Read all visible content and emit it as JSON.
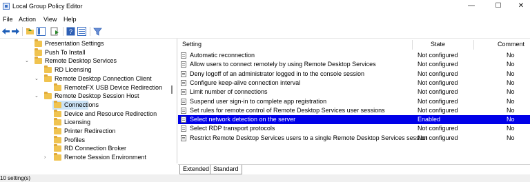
{
  "window": {
    "title": "Local Group Policy Editor",
    "minimize": "—",
    "maximize": "☐",
    "close": "✕"
  },
  "menu": [
    "File",
    "Action",
    "View",
    "Help"
  ],
  "tree": [
    {
      "label": "Presentation Settings",
      "level": 3,
      "chevron": ""
    },
    {
      "label": "Push To Install",
      "level": 3,
      "chevron": ""
    },
    {
      "label": "Remote Desktop Services",
      "level": 3,
      "chevron": "expanded"
    },
    {
      "label": "RD Licensing",
      "level": 4,
      "chevron": ""
    },
    {
      "label": "Remote Desktop Connection Client",
      "level": 4,
      "chevron": "expanded"
    },
    {
      "label": "RemoteFX USB Device Redirection",
      "level": 5,
      "chevron": ""
    },
    {
      "label": "Remote Desktop Session Host",
      "level": 4,
      "chevron": "expanded"
    },
    {
      "label": "Connections",
      "level": 5,
      "chevron": "",
      "selected": true
    },
    {
      "label": "Device and Resource Redirection",
      "level": 5,
      "chevron": ""
    },
    {
      "label": "Licensing",
      "level": 5,
      "chevron": ""
    },
    {
      "label": "Printer Redirection",
      "level": 5,
      "chevron": ""
    },
    {
      "label": "Profiles",
      "level": 5,
      "chevron": ""
    },
    {
      "label": "RD Connection Broker",
      "level": 5,
      "chevron": ""
    },
    {
      "label": "Remote Session Environment",
      "level": 5,
      "chevron": "collapsed"
    }
  ],
  "table": {
    "headers": {
      "setting": "Setting",
      "state": "State",
      "comment": "Comment"
    },
    "rows": [
      {
        "setting": "Automatic reconnection",
        "state": "Not configured",
        "comment": "No"
      },
      {
        "setting": "Allow users to connect remotely by using Remote Desktop Services",
        "state": "Not configured",
        "comment": "No"
      },
      {
        "setting": "Deny logoff of an administrator logged in to the console session",
        "state": "Not configured",
        "comment": "No"
      },
      {
        "setting": "Configure keep-alive connection interval",
        "state": "Not configured",
        "comment": "No"
      },
      {
        "setting": "Limit number of connections",
        "state": "Not configured",
        "comment": "No"
      },
      {
        "setting": "Suspend user sign-in to complete app registration",
        "state": "Not configured",
        "comment": "No"
      },
      {
        "setting": "Set rules for remote control of Remote Desktop Services user sessions",
        "state": "Not configured",
        "comment": "No"
      },
      {
        "setting": "Select network detection on the server",
        "state": "Enabled",
        "comment": "No",
        "selected": true
      },
      {
        "setting": "Select RDP transport protocols",
        "state": "Not configured",
        "comment": "No"
      },
      {
        "setting": "Restrict Remote Desktop Services users to a single Remote Desktop Services session",
        "state": "Not configured",
        "comment": "No"
      }
    ]
  },
  "tabs": [
    "Extended",
    "Standard"
  ],
  "status": "10 setting(s)",
  "colors": {
    "selection": "#0000e8",
    "tree_selection": "#cce4f7",
    "folder": "#f0c34f"
  },
  "icons": {
    "back": "back-arrow-icon",
    "forward": "forward-arrow-icon",
    "filter": "filter-icon",
    "help": "help-icon"
  }
}
